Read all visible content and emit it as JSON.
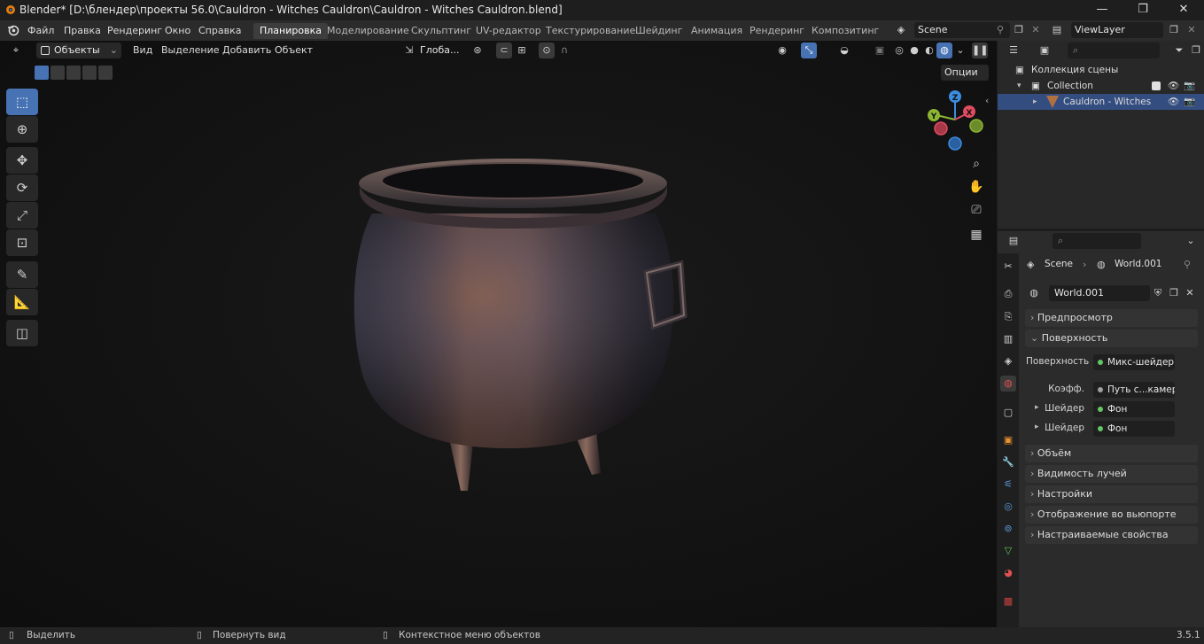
{
  "window": {
    "title": "Blender* [D:\\блендер\\проекты 56.0\\Cauldron - Witches Cauldron\\Cauldron - Witches Cauldron.blend]",
    "minimize": "—",
    "maximize": "❐",
    "close": "✕"
  },
  "menu": [
    "Файл",
    "Правка",
    "Рендеринг",
    "Окно",
    "Справка"
  ],
  "workspaces": {
    "tabs": [
      "Планировка",
      "Моделирование",
      "Скульптинг",
      "UV-редактор",
      "Текстурирование",
      "Шейдинг",
      "Анимация",
      "Рендеринг",
      "Композитинг"
    ],
    "active": "Планировка"
  },
  "scene_field": "Scene",
  "viewlayer_field": "ViewLayer",
  "viewport_header": {
    "mode": "Объекты",
    "menus": [
      "Вид",
      "Выделение",
      "Добавить",
      "Объект"
    ],
    "orientation": "Глоба...",
    "options": "Опции"
  },
  "gizmo": {
    "z": "Z",
    "y": "Y",
    "x": "X"
  },
  "outliner": {
    "scene_collection": "Коллекция сцены",
    "collection": "Collection",
    "object": "Cauldron - Witches C"
  },
  "properties": {
    "breadcrumb_scene": "Scene",
    "breadcrumb_world": "World.001",
    "world_name": "World.001",
    "panels": {
      "preview": "Предпросмотр",
      "surface": "Поверхность",
      "volume": "Объём",
      "ray_visibility": "Видимость лучей",
      "settings": "Настройки",
      "viewport_display": "Отображение во вьюпорте",
      "custom_props": "Настраиваемые свойства"
    },
    "surface_rows": {
      "surface_label": "Поверхность",
      "surface_value": "Микс-шейдер",
      "fac_label": "Коэфф.",
      "fac_value": "Путь с...камеры",
      "shader1_label": "Шейдер",
      "shader1_value": "Фон",
      "shader2_label": "Шейдер",
      "shader2_value": "Фон"
    }
  },
  "statusbar": {
    "select": "Выделить",
    "rotate": "Повернуть вид",
    "context_menu": "Контекстное меню объектов",
    "version": "3.5.1"
  },
  "colors": {
    "accent": "#4772b3",
    "selection": "#334d80",
    "gizmo_x": "#e04b5f",
    "gizmo_y": "#8cb632",
    "gizmo_z": "#3b8de0"
  }
}
